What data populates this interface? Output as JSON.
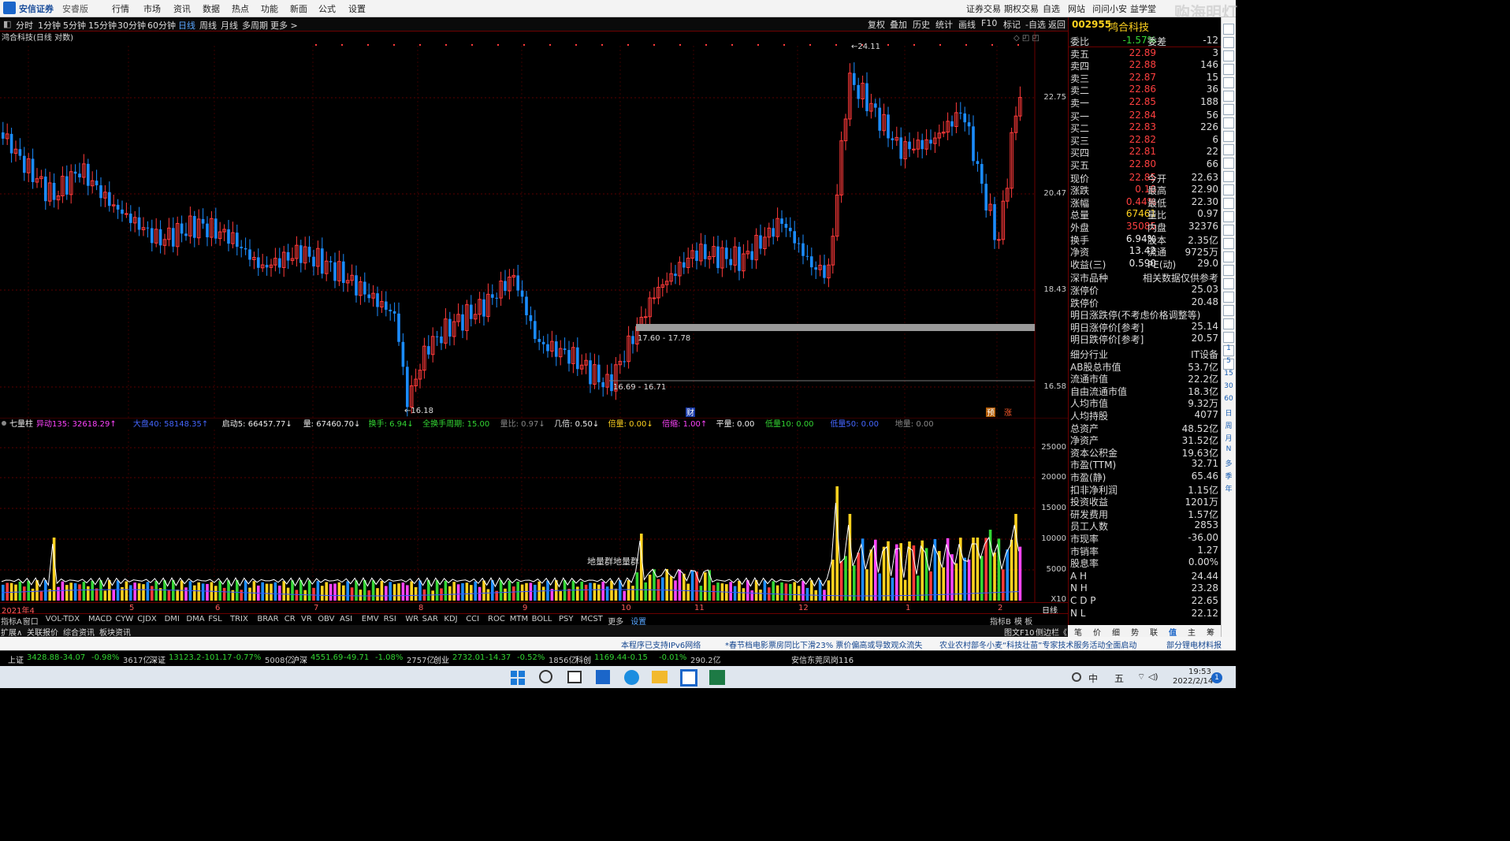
{
  "app": {
    "title_brand": "安信证券",
    "title_edition": "安睿版"
  },
  "top_menu": [
    "行情",
    "市场",
    "资讯",
    "数据",
    "热点",
    "功能",
    "新面",
    "公式",
    "设置"
  ],
  "top_right": [
    "证券交易",
    "期权交易",
    "自选",
    "网站",
    "问问小安",
    "益学堂"
  ],
  "watermark": "购海明灯",
  "periods": [
    "分时",
    "1分钟",
    "5分钟",
    "15分钟",
    "30分钟",
    "60分钟",
    "日线",
    "周线",
    "月线",
    "多周期",
    "更多 >"
  ],
  "selected_period": "日线",
  "chart_tools": [
    "复权",
    "叠加",
    "历史",
    "统计",
    "画线",
    "F10",
    "标记",
    "-自选",
    "返回"
  ],
  "chart_title": "鸿合科技(日线 对数)",
  "price_axis": [
    "22.75",
    "20.47",
    "18.43",
    "16.58"
  ],
  "annotations": {
    "high": "24.11",
    "low": "16.18",
    "range1": "16.69 - 16.71",
    "range2": "17.60 - 17.78",
    "marker_cai": "财",
    "marker_yu": "预",
    "marker_zhang": "涨",
    "vol_label": "地量群地量群"
  },
  "volume_bar": {
    "name": "七量柱",
    "items": [
      {
        "k": "异动135:",
        "v": "32618.29↑",
        "c": "#ff44ff"
      },
      {
        "k": "大盘40:",
        "v": "58148.35↑",
        "c": "#4466ff"
      },
      {
        "k": "启动5:",
        "v": "66457.77↓",
        "c": "#eeeeee"
      },
      {
        "k": "量:",
        "v": "67460.70↓",
        "c": "#eeeeee"
      },
      {
        "k": "换手:",
        "v": "6.94↓",
        "c": "#33d633"
      },
      {
        "k": "全换手周期:",
        "v": "15.00",
        "c": "#33d633"
      },
      {
        "k": "量比:",
        "v": "0.97↓",
        "c": "#888888"
      },
      {
        "k": "几倍:",
        "v": "0.50↓",
        "c": "#eeeeee"
      },
      {
        "k": "倍量:",
        "v": "0.00↓",
        "c": "#ffd21f"
      },
      {
        "k": "倍缩:",
        "v": "1.00↑",
        "c": "#ff44ff"
      },
      {
        "k": "平量:",
        "v": "0.00",
        "c": "#eeeeee"
      },
      {
        "k": "低量10:",
        "v": "0.00",
        "c": "#33d633"
      },
      {
        "k": "低量50:",
        "v": "0.00",
        "c": "#4466ff"
      },
      {
        "k": "地量:",
        "v": "0.00",
        "c": "#888888"
      }
    ]
  },
  "vol_axis": [
    "25000",
    "20000",
    "15000",
    "10000",
    "5000",
    "X10"
  ],
  "x_axis": [
    "2021年4",
    "5",
    "6",
    "7",
    "8",
    "9",
    "10",
    "11",
    "12",
    "1",
    "2"
  ],
  "x_axis_right": "日线",
  "indicator_tabs": [
    "指标A",
    "窗口",
    "VOL-TDX",
    "MACD",
    "CYW",
    "CJDX",
    "DMI",
    "DMA",
    "FSL",
    "TRIX",
    "BRAR",
    "CR",
    "VR",
    "OBV",
    "ASI",
    "EMV",
    "RSI",
    "WR",
    "SAR",
    "KDJ",
    "CCI",
    "ROC",
    "MTM",
    "BOLL",
    "PSY",
    "MCST",
    "更多",
    "设置"
  ],
  "indicator_right": [
    "指标B",
    "模 板"
  ],
  "extras": [
    "扩展∧",
    "关联报价",
    "综合资讯",
    "板块资讯"
  ],
  "extras_right": [
    "图文F10",
    "侧边栏《"
  ],
  "panel": {
    "code": "002955",
    "name": "鸿合科技",
    "order_diff": {
      "k": "委比",
      "v": "-1.57%",
      "k2": "委差",
      "v2": "-12"
    },
    "asks": [
      {
        "k": "卖五",
        "p": "22.89",
        "q": "3"
      },
      {
        "k": "卖四",
        "p": "22.88",
        "q": "146"
      },
      {
        "k": "卖三",
        "p": "22.87",
        "q": "15"
      },
      {
        "k": "卖二",
        "p": "22.86",
        "q": "36"
      },
      {
        "k": "卖一",
        "p": "22.85",
        "q": "188"
      }
    ],
    "bids": [
      {
        "k": "买一",
        "p": "22.84",
        "q": "56"
      },
      {
        "k": "买二",
        "p": "22.83",
        "q": "226"
      },
      {
        "k": "买三",
        "p": "22.82",
        "q": "6"
      },
      {
        "k": "买四",
        "p": "22.81",
        "q": "22"
      },
      {
        "k": "买五",
        "p": "22.80",
        "q": "66"
      }
    ],
    "quote": [
      {
        "k": "现价",
        "v": "22.85",
        "vc": "red",
        "k2": "今开",
        "v2": "22.63",
        "v2c": "red"
      },
      {
        "k": "涨跌",
        "v": "0.10",
        "vc": "red",
        "k2": "最高",
        "v2": "22.90",
        "v2c": "red"
      },
      {
        "k": "涨幅",
        "v": "0.44%",
        "vc": "red",
        "k2": "最低",
        "v2": "22.30",
        "v2c": "grn"
      },
      {
        "k": "总量",
        "v": "67461",
        "vc": "yel",
        "k2": "量比",
        "v2": "0.97",
        "v2c": "yel"
      },
      {
        "k": "外盘",
        "v": "35085",
        "vc": "red",
        "k2": "内盘",
        "v2": "32376",
        "v2c": "grn"
      },
      {
        "k": "换手",
        "v": "6.94%",
        "vc": "wht",
        "k2": "股本",
        "v2": "2.35亿",
        "v2c": "wht"
      },
      {
        "k": "净资",
        "v": "13.42",
        "vc": "wht",
        "k2": "流通",
        "v2": "9725万",
        "v2c": "wht"
      },
      {
        "k": "收益(三)",
        "v": "0.590",
        "vc": "wht",
        "k2": "PE(动)",
        "v2": "29.0",
        "v2c": "wht"
      }
    ],
    "ref_header": {
      "k": "深市品种",
      "v": "相关数据仅供参考"
    },
    "limits": [
      {
        "k": "涨停价",
        "v": "25.03",
        "c": "red"
      },
      {
        "k": "跌停价",
        "v": "20.48",
        "c": "grn"
      }
    ],
    "next_header": "明日涨跌停(不考虑价格调整等)",
    "next_limits": [
      {
        "k": "明日涨停价[参考]",
        "v": "25.14",
        "c": "red"
      },
      {
        "k": "明日跌停价[参考]",
        "v": "20.57",
        "c": "grn"
      }
    ],
    "industry": {
      "k": "细分行业",
      "v": "IT设备"
    },
    "fund": [
      {
        "k": "AB股总市值",
        "v": "53.7亿"
      },
      {
        "k": "流通市值",
        "v": "22.2亿"
      },
      {
        "k": "自由流通市值",
        "v": "18.3亿"
      },
      {
        "k": "人均市值",
        "v": "9.32万"
      },
      {
        "k": "人均持股",
        "v": "4077"
      },
      {
        "k": "总资产",
        "v": "48.52亿"
      },
      {
        "k": "净资产",
        "v": "31.52亿"
      },
      {
        "k": "资本公积金",
        "v": "19.63亿"
      },
      {
        "k": "市盈(TTM)",
        "v": "32.71"
      },
      {
        "k": "市盈(静)",
        "v": "65.46"
      },
      {
        "k": "扣非净利润",
        "v": "1.15亿"
      },
      {
        "k": "投资收益",
        "v": "1201万"
      },
      {
        "k": "研发费用",
        "v": "1.57亿"
      },
      {
        "k": "员工人数",
        "v": "2853"
      },
      {
        "k": "市现率",
        "v": "-36.00"
      },
      {
        "k": "市销率",
        "v": "1.27"
      },
      {
        "k": "股息率",
        "v": "0.00%"
      }
    ],
    "ah": [
      {
        "k": "A H",
        "v": "24.44",
        "c": "red"
      },
      {
        "k": "N H",
        "v": "23.28",
        "c": "red"
      },
      {
        "k": "C D P",
        "v": "22.65",
        "c": "wht"
      },
      {
        "k": "N L",
        "v": "22.12",
        "c": "wht"
      }
    ],
    "tabs": [
      "笔",
      "价",
      "细",
      "势",
      "联",
      "值",
      "主",
      "筹"
    ]
  },
  "sidebar_items": [
    "1",
    "5",
    "15",
    "30",
    "60",
    "日",
    "周",
    "月",
    "N",
    "多",
    "季",
    "年"
  ],
  "news": [
    "本程序已支持IPv6网络",
    "*春节档电影票房同比下滑23% 票价偏高或导致观众流失",
    "农业农村部冬小麦“科技壮苗”专家技术服务活动全面启动",
    "部分锂电材料报"
  ],
  "status": [
    {
      "name": "上证",
      "v": "3428.88",
      "d": "-34.07",
      "p": "-0.98%",
      "a": "3617亿"
    },
    {
      "name": "深证",
      "v": "13123.2",
      "d": "-101.17",
      "p": "-0.77%",
      "a": "5008亿"
    },
    {
      "name": "沪深",
      "v": "4551.69",
      "d": "-49.71",
      "p": "-1.08%",
      "a": "2757亿"
    },
    {
      "name": "创业",
      "v": "2732.01",
      "d": "-14.37",
      "p": "-0.52%",
      "a": "1856亿"
    },
    {
      "name": "科创",
      "v": "1169.44",
      "d": "-0.15",
      "p": "-0.01%",
      "a": "290.2亿"
    }
  ],
  "status_broker": "安信东莞凤岗116",
  "clock": {
    "time": "19:53",
    "date": "2022/2/14"
  },
  "tray": [
    "中",
    "五"
  ],
  "notif": "1"
}
